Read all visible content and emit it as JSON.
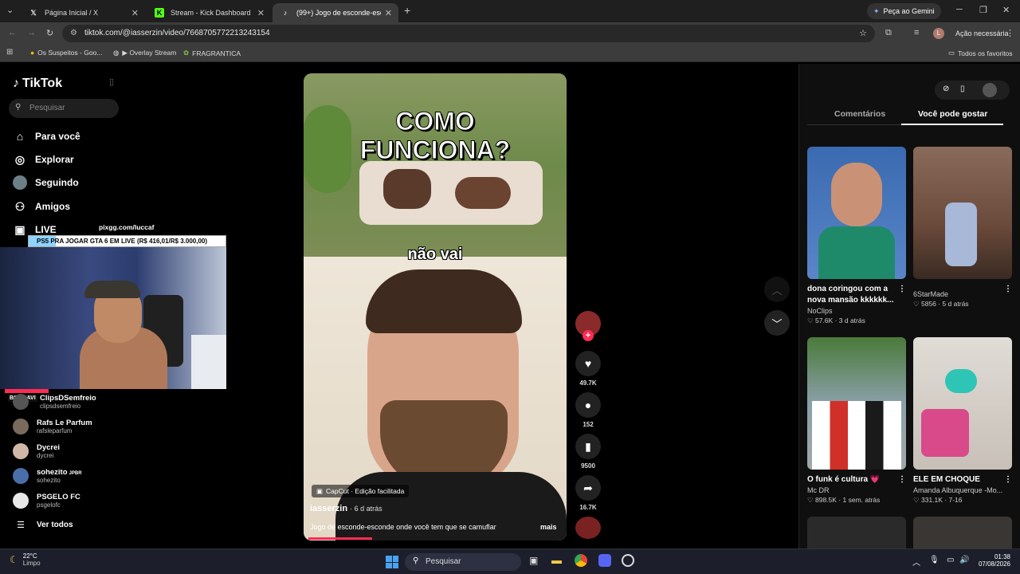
{
  "browser": {
    "tabs": [
      {
        "title": "Página Inicial / X",
        "icon": "x-logo-icon"
      },
      {
        "title": "Stream - Kick Dashboard",
        "icon": "kick-logo-icon"
      },
      {
        "title": "(99+) Jogo de esconde-esco",
        "icon": "tiktok-logo-icon"
      }
    ],
    "gemini_label": "Peça ao Gemini",
    "url": "tiktok.com/@iasserzin/video/7668705772213243154",
    "action_label": "Ação necessária",
    "profile_initial": "L",
    "bookmarks": [
      "Os Suspeitos - Goo...",
      "▶ Overlay Stream",
      "FRAGRANTICA"
    ],
    "all_bookmarks": "Todos os favoritos"
  },
  "sidebar": {
    "logo": "TikTok",
    "search_placeholder": "Pesquisar",
    "nav": [
      {
        "label": "Para você",
        "icon": "home-icon"
      },
      {
        "label": "Explorar",
        "icon": "compass-icon"
      },
      {
        "label": "Seguindo",
        "icon": "following-avatar-icon"
      },
      {
        "label": "Amigos",
        "icon": "friends-icon"
      },
      {
        "label": "LIVE",
        "icon": "live-icon"
      }
    ],
    "following": [
      {
        "name": "ClipsDSemfreio",
        "handle": "clipsdsemfreio"
      },
      {
        "name": "Rafs Le Parfum",
        "handle": "rafsleparfum"
      },
      {
        "name": "Dycrei",
        "handle": "dycrei"
      },
      {
        "name": "sohezito",
        "badge": "JPBR",
        "handle": "sohezito"
      },
      {
        "name": "PSGELO FC",
        "handle": "psgelofc"
      }
    ],
    "see_all": "Ver todos"
  },
  "overlay": {
    "pix_label": "pixgg.com/luccaf",
    "goal_text": "PS5 PRA JOGAR GTA 6 EM LIVE (R$ 416,01/R$ 3.000,00)",
    "goal_progress": 0.139,
    "tag": "BOA LAVI"
  },
  "video": {
    "headline_line1": "COMO",
    "headline_line2": "FUNCIONA?",
    "subtitle": "não vai",
    "capcut_label": "CapCut · Edição facilitada",
    "author": "iasserzin",
    "age": "· 6 d atrás",
    "caption": "Jogo de esconde-esconde onde você tem que se camuflar",
    "more": "mais"
  },
  "actions": {
    "likes": "49.7K",
    "comments": "152",
    "saves": "9500",
    "shares": "16.7K"
  },
  "right_panel": {
    "tabs": [
      "Comentários",
      "Você pode gostar"
    ],
    "active_tab": 1,
    "cards": [
      {
        "title": "dona coringou com a nova mansão kkkkkk...",
        "author": "NoClips",
        "likes": "57.6K",
        "age": "3 d atrás"
      },
      {
        "title": "",
        "author": "6StarMade",
        "likes": "5856",
        "age": "5 d atrás"
      },
      {
        "title": "O funk é cultura 💗",
        "author": "Mc DR",
        "likes": "898.5K",
        "age": "1 sem. atrás"
      },
      {
        "title": "ELE EM CHOQUE",
        "author": "Amanda Albuquerque -Mo...",
        "likes": "331.1K",
        "age": "7-16"
      }
    ]
  },
  "taskbar": {
    "temp": "22°C",
    "weather": "Limpo",
    "search_placeholder": "Pesquisar",
    "time": "01:38",
    "date": "07/08/2026"
  },
  "colors": {
    "accent": "#fe2c55",
    "tab_bg": "#1f1f1f",
    "toolbar_bg": "#3c3c3c"
  }
}
